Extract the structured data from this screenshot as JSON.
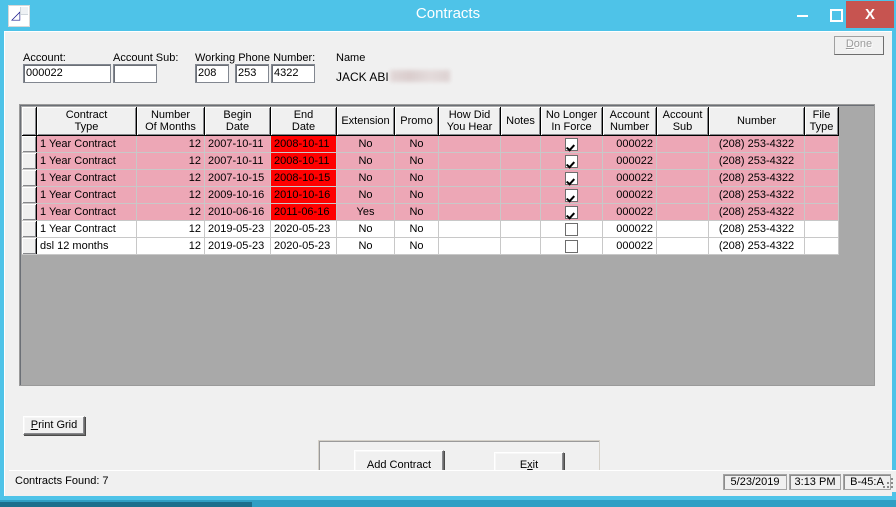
{
  "window": {
    "title": "Contracts",
    "icon": "application-document-icon",
    "controls": {
      "minimize": "minimize-icon",
      "maximize": "maximize-icon",
      "close": "X"
    },
    "accent_color": "#4ec3e8",
    "close_color": "#c75450"
  },
  "toolbar": {
    "done_label": "Done"
  },
  "form": {
    "account_label": "Account:",
    "account_value": "000022",
    "account_sub_label": "Account Sub:",
    "account_sub_value": "",
    "phone_label": "Working Phone Number:",
    "phone_area": "208",
    "phone_prefix": "253",
    "phone_line": "4322",
    "name_label": "Name",
    "name_value": "JACK ABI"
  },
  "grid": {
    "columns": [
      "Contract\nType",
      "Number\nOf Months",
      "Begin\nDate",
      "End\nDate",
      "Extension",
      "Promo",
      "How Did\nYou Hear",
      "Notes",
      "No Longer\nIn Force",
      "Account\nNumber",
      "Account\nSub",
      "Number",
      "File\nType"
    ],
    "rows": [
      {
        "contract_type": "1 Year Contract",
        "months": "12",
        "begin_date": "2007-10-11",
        "end_date": "2008-10-11",
        "end_date_alert": true,
        "extension": "No",
        "promo": "No",
        "how_did_you_hear": "",
        "notes": "",
        "no_longer_in_force": true,
        "account_number": "000022",
        "account_sub": "",
        "number": "(208) 253-4322",
        "file_type": "",
        "highlight": "pink"
      },
      {
        "contract_type": "1 Year Contract",
        "months": "12",
        "begin_date": "2007-10-11",
        "end_date": "2008-10-11",
        "end_date_alert": true,
        "extension": "No",
        "promo": "No",
        "how_did_you_hear": "",
        "notes": "",
        "no_longer_in_force": true,
        "account_number": "000022",
        "account_sub": "",
        "number": "(208) 253-4322",
        "file_type": "",
        "highlight": "pink"
      },
      {
        "contract_type": "1 Year Contract",
        "months": "12",
        "begin_date": "2007-10-15",
        "end_date": "2008-10-15",
        "end_date_alert": true,
        "extension": "No",
        "promo": "No",
        "how_did_you_hear": "",
        "notes": "",
        "no_longer_in_force": true,
        "account_number": "000022",
        "account_sub": "",
        "number": "(208) 253-4322",
        "file_type": "",
        "highlight": "pink"
      },
      {
        "contract_type": "1 Year Contract",
        "months": "12",
        "begin_date": "2009-10-16",
        "end_date": "2010-10-16",
        "end_date_alert": true,
        "extension": "No",
        "promo": "No",
        "how_did_you_hear": "",
        "notes": "",
        "no_longer_in_force": true,
        "account_number": "000022",
        "account_sub": "",
        "number": "(208) 253-4322",
        "file_type": "",
        "highlight": "pink"
      },
      {
        "contract_type": "1 Year Contract",
        "months": "12",
        "begin_date": "2010-06-16",
        "end_date": "2011-06-16",
        "end_date_alert": true,
        "extension": "Yes",
        "promo": "No",
        "how_did_you_hear": "",
        "notes": "",
        "no_longer_in_force": true,
        "account_number": "000022",
        "account_sub": "",
        "number": "(208) 253-4322",
        "file_type": "",
        "highlight": "pink"
      },
      {
        "contract_type": "1 Year Contract",
        "months": "12",
        "begin_date": "2019-05-23",
        "end_date": "2020-05-23",
        "end_date_alert": false,
        "extension": "No",
        "promo": "No",
        "how_did_you_hear": "",
        "notes": "",
        "no_longer_in_force": false,
        "account_number": "000022",
        "account_sub": "",
        "number": "(208) 253-4322",
        "file_type": "",
        "highlight": "white"
      },
      {
        "contract_type": "dsl 12 months",
        "months": "12",
        "begin_date": "2019-05-23",
        "end_date": "2020-05-23",
        "end_date_alert": false,
        "extension": "No",
        "promo": "No",
        "how_did_you_hear": "",
        "notes": "",
        "no_longer_in_force": false,
        "account_number": "000022",
        "account_sub": "",
        "number": "(208) 253-4322",
        "file_type": "",
        "highlight": "white"
      }
    ],
    "alert_color": "#ff0000",
    "highlight_color": "#eda7b6"
  },
  "actions": {
    "print_grid_label": "Print Grid",
    "print_grid_accel": "P",
    "add_contract_label": "Add Contract",
    "exit_label": "Exit",
    "exit_accel": "x"
  },
  "statusbar": {
    "message": "Contracts Found: 7",
    "date": "5/23/2019",
    "time": "3:13 PM",
    "terminal": "B-45:A"
  }
}
